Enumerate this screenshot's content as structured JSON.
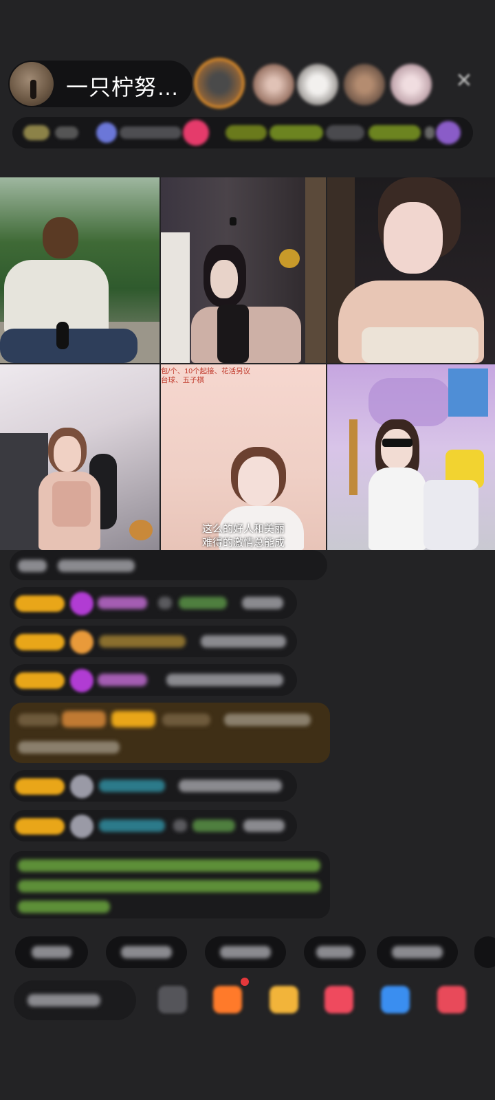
{
  "header": {
    "host_name": "一只柠努…",
    "viewer_avatars": [
      {
        "name": "viewer-avatar-1",
        "color": "#9a6a3a"
      },
      {
        "name": "viewer-avatar-2",
        "color": "#a98c7d"
      },
      {
        "name": "viewer-avatar-3",
        "color": "#cfc9c2"
      },
      {
        "name": "viewer-avatar-4",
        "color": "#8c7a6e"
      },
      {
        "name": "viewer-avatar-5",
        "color": "#c8b0b8"
      }
    ],
    "close_glyph": "✕"
  },
  "grid": {
    "tile2_caption": "包/个、10个起接、花活另议\n台球、五子棋",
    "tile5_subtitle_line1": "这么的好人和美丽",
    "tile5_subtitle_line2": "难得的激情总能成"
  },
  "colors": {
    "background": "#232325",
    "badge": "#e9a619",
    "diamond_icon": "#b13cd3",
    "username_pink": "#c06ad2",
    "username_teal": "#2c8fa3",
    "green_text": "#76b243",
    "gift_orange": "#ff7a2a",
    "notification_dot": "#e5383b"
  }
}
